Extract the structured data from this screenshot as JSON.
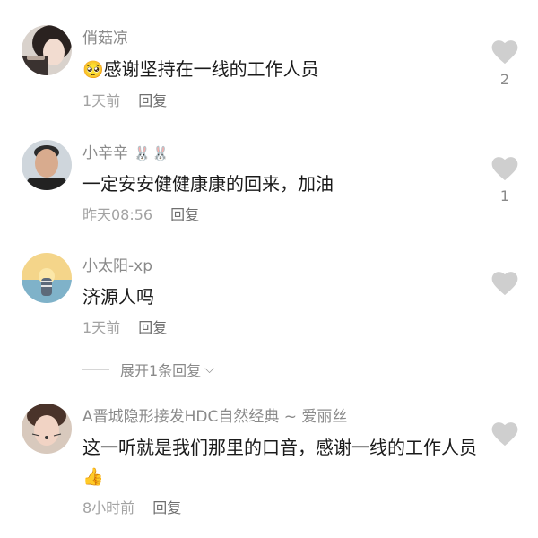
{
  "comments": [
    {
      "username": "俏菇凉",
      "badges": "",
      "emoji": "🥺",
      "text": "感谢坚持在一线的工作人员",
      "time": "1天前",
      "reply_label": "回复",
      "likes": "2"
    },
    {
      "username": "小辛辛",
      "badges": "🐰🐰",
      "emoji": "",
      "text": "一定安安健健康康的回来，加油",
      "time": "昨天08:56",
      "reply_label": "回复",
      "likes": "1"
    },
    {
      "username": "小太阳-xp",
      "badges": "",
      "emoji": "",
      "text": "济源人吗",
      "time": "1天前",
      "reply_label": "回复",
      "likes": ""
    },
    {
      "username": "A晋城隐形接发HDC自然经典 ~ 爱丽丝",
      "badges": "",
      "emoji": "👍",
      "text": "这一听就是我们那里的口音，感谢一线的工作人员",
      "time": "8小时前",
      "reply_label": "回复",
      "likes": ""
    }
  ],
  "expand_replies": {
    "label": "展开1条回复"
  },
  "colors": {
    "heart": "#cfcfcf",
    "username": "#8a8a8a",
    "text": "#1a1a1a",
    "meta": "#a3a3a3"
  }
}
